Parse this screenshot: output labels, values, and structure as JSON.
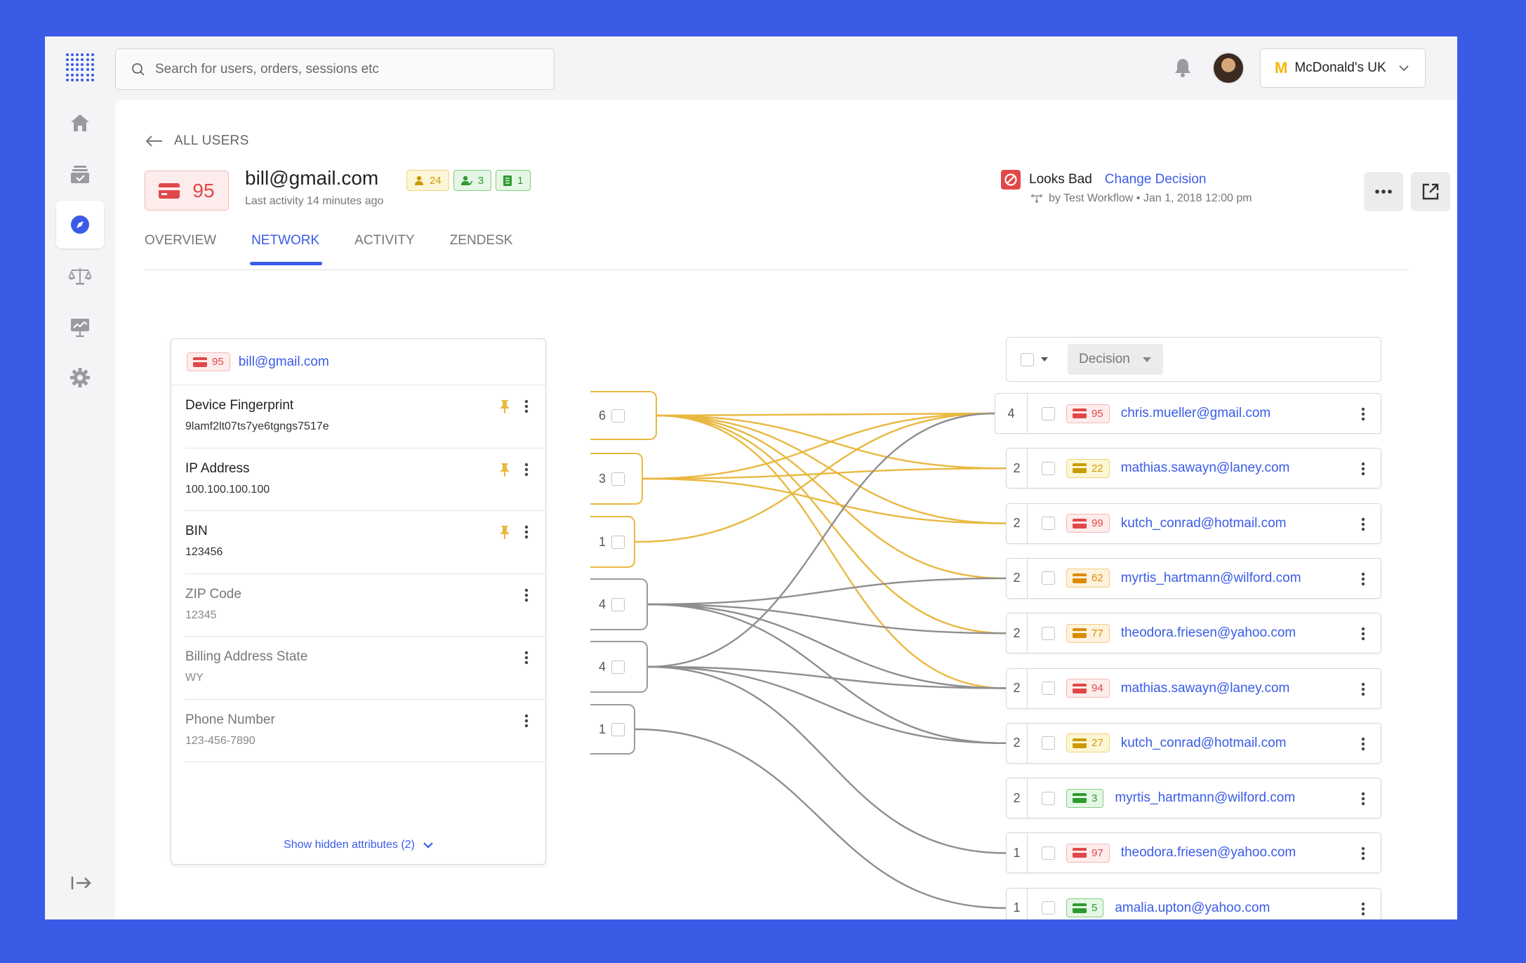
{
  "search": {
    "placeholder": "Search for users, orders, sessions etc"
  },
  "org": {
    "name": "McDonald's UK",
    "logo": "M"
  },
  "sidebar": {
    "items": [
      "home",
      "orders",
      "explore",
      "decisions",
      "reports",
      "settings"
    ],
    "active": "explore",
    "logout": "logout"
  },
  "back": {
    "label": "ALL USERS"
  },
  "user": {
    "score": "95",
    "email": "bill@gmail.com",
    "last_activity": "Last activity 14 minutes ago",
    "chips": [
      {
        "icon": "user-icon",
        "value": "24",
        "color": "#c99b00"
      },
      {
        "icon": "user-check-icon",
        "value": "3",
        "color": "#2e9b2e"
      },
      {
        "icon": "document-icon",
        "value": "1",
        "color": "#2e9b2e"
      }
    ]
  },
  "decision": {
    "label": "Looks Bad",
    "change": "Change Decision",
    "by": "by Test Workflow • Jan 1, 2018 12:00 pm"
  },
  "tabs": [
    "OVERVIEW",
    "NETWORK",
    "ACTIVITY",
    "ZENDESK"
  ],
  "active_tab": "NETWORK",
  "network": {
    "root": {
      "score": "95",
      "email": "bill@gmail.com"
    },
    "attributes": [
      {
        "name": "Device Fingerprint",
        "value": "9lamf2lt07ts7ye6tgngs7517e",
        "pinned": true,
        "count": "6",
        "color": "yellow"
      },
      {
        "name": "IP Address",
        "value": "100.100.100.100",
        "pinned": true,
        "count": "3",
        "color": "yellow"
      },
      {
        "name": "BIN",
        "value": "123456",
        "pinned": true,
        "count": "1",
        "color": "yellow"
      },
      {
        "name": "ZIP Code",
        "value": "12345",
        "pinned": false,
        "count": "4",
        "color": "gray"
      },
      {
        "name": "Billing Address State",
        "value": "WY",
        "pinned": false,
        "count": "4",
        "color": "gray"
      },
      {
        "name": "Phone Number",
        "value": "123-456-7890",
        "pinned": false,
        "count": "1",
        "color": "gray"
      }
    ],
    "show_hidden": "Show hidden attributes (2)",
    "decision_filter": "Decision",
    "users": [
      {
        "count": "4",
        "score": "95",
        "level": "r",
        "email": "chris.mueller@gmail.com"
      },
      {
        "count": "2",
        "score": "22",
        "level": "y",
        "email": "mathias.sawayn@laney.com"
      },
      {
        "count": "2",
        "score": "99",
        "level": "r",
        "email": "kutch_conrad@hotmail.com"
      },
      {
        "count": "2",
        "score": "62",
        "level": "o",
        "email": "myrtis_hartmann@wilford.com"
      },
      {
        "count": "2",
        "score": "77",
        "level": "o",
        "email": "theodora.friesen@yahoo.com"
      },
      {
        "count": "2",
        "score": "94",
        "level": "r",
        "email": "mathias.sawayn@laney.com"
      },
      {
        "count": "2",
        "score": "27",
        "level": "y",
        "email": "kutch_conrad@hotmail.com"
      },
      {
        "count": "2",
        "score": "3",
        "level": "g",
        "email": "myrtis_hartmann@wilford.com"
      },
      {
        "count": "1",
        "score": "97",
        "level": "r",
        "email": "theodora.friesen@yahoo.com"
      },
      {
        "count": "1",
        "score": "5",
        "level": "g",
        "email": "amalia.upton@yahoo.com"
      }
    ],
    "connections": [
      [
        0,
        0
      ],
      [
        0,
        1
      ],
      [
        0,
        2
      ],
      [
        0,
        3
      ],
      [
        0,
        4
      ],
      [
        0,
        5
      ],
      [
        1,
        0
      ],
      [
        1,
        1
      ],
      [
        1,
        2
      ],
      [
        2,
        0
      ],
      [
        3,
        3
      ],
      [
        3,
        4
      ],
      [
        3,
        5
      ],
      [
        3,
        6
      ],
      [
        4,
        0
      ],
      [
        4,
        5
      ],
      [
        4,
        6
      ],
      [
        4,
        8
      ],
      [
        5,
        9
      ]
    ]
  },
  "colors": {
    "accent": "#3a5be6",
    "yellow_link": "#e9b840",
    "gray_link": "#8e8e8e",
    "bad": "#e04848"
  }
}
